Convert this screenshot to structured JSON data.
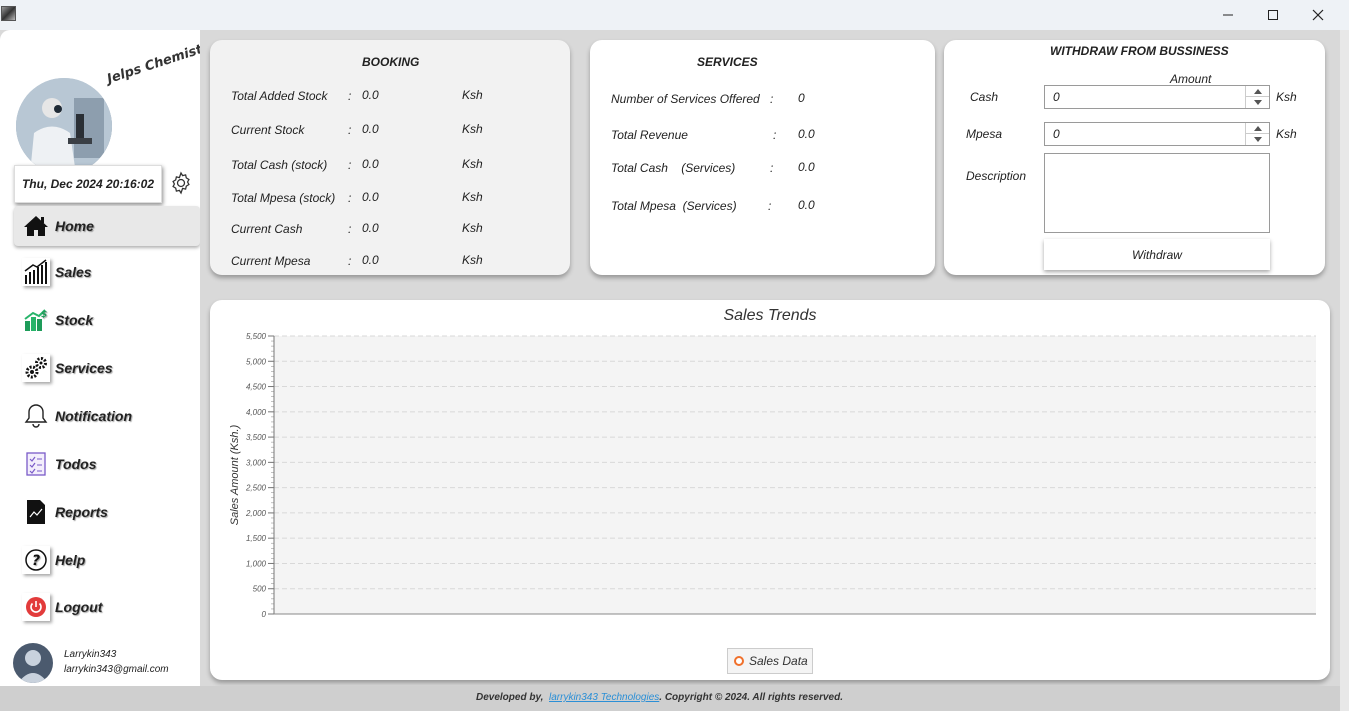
{
  "window": {
    "controls": {
      "minimize": "minimize-icon",
      "maximize": "maximize-icon",
      "close": "close-icon"
    }
  },
  "sidebar": {
    "brand": "Jelps Chemist",
    "datetime": "Thu, Dec 2024 20:16:02",
    "settings_icon": "gear-icon",
    "items": [
      {
        "label": "Home",
        "icon": "home-icon",
        "active": true
      },
      {
        "label": "Sales",
        "icon": "bar-chart-icon"
      },
      {
        "label": "Stock",
        "icon": "stock-icon"
      },
      {
        "label": "Services",
        "icon": "gears-icon"
      },
      {
        "label": "Notification",
        "icon": "bell-icon"
      },
      {
        "label": "Todos",
        "icon": "checklist-icon"
      },
      {
        "label": "Reports",
        "icon": "report-icon"
      },
      {
        "label": "Help",
        "icon": "help-icon"
      },
      {
        "label": "Logout",
        "icon": "power-icon"
      }
    ],
    "user": {
      "name": "Larrykin343",
      "email": "larrykin343@gmail.com"
    }
  },
  "booking": {
    "title": "BOOKING",
    "rows": [
      {
        "label": "Total Added Stock",
        "sep": ":",
        "value": "0.0",
        "unit": "Ksh"
      },
      {
        "label": "Current Stock",
        "sep": ":",
        "value": "0.0",
        "unit": "Ksh"
      },
      {
        "label": "Total Cash (stock)",
        "sep": ":",
        "value": "0.0",
        "unit": "Ksh"
      },
      {
        "label": "Total Mpesa (stock)",
        "sep": ":",
        "value": "0.0",
        "unit": "Ksh"
      },
      {
        "label": "Current Cash",
        "sep": ":",
        "value": "0.0",
        "unit": "Ksh"
      },
      {
        "label": "Current Mpesa",
        "sep": ":",
        "value": "0.0",
        "unit": "Ksh"
      }
    ]
  },
  "services": {
    "title": "SERVICES",
    "rows": [
      {
        "label": "Number of Services Offered",
        "sep": ":",
        "value": "0"
      },
      {
        "label": "Total Revenue",
        "sep": ":",
        "value": "0.0"
      },
      {
        "label": "Total Cash    (Services)",
        "sep": ":",
        "value": "0.0"
      },
      {
        "label": "Total Mpesa  (Services)",
        "sep": ":",
        "value": "0.0"
      }
    ]
  },
  "withdraw": {
    "title": "WITHDRAW FROM BUSSINESS",
    "amount_header": "Amount",
    "cash_label": "Cash",
    "cash_value": "0",
    "cash_unit": "Ksh",
    "mpesa_label": "Mpesa",
    "mpesa_value": "0",
    "mpesa_unit": "Ksh",
    "description_label": "Description",
    "description_value": "",
    "button_label": "Withdraw"
  },
  "chart_data": {
    "type": "line",
    "title": "Sales Trends",
    "ylabel": "Sales Amount (Ksh.)",
    "xlabel": "",
    "ylim": [
      0,
      5500
    ],
    "yticks": [
      "0",
      "500",
      "1,000",
      "1,500",
      "2,000",
      "2,500",
      "3,000",
      "3,500",
      "4,000",
      "4,500",
      "5,000",
      "5,500"
    ],
    "series": [
      {
        "name": "Sales Data",
        "values": [],
        "color": "#f0702b"
      }
    ],
    "grid": true,
    "legend": "bottom-center"
  },
  "footer": {
    "prefix": "Developed by,",
    "company": "larrykin343 Technologies",
    "suffix": ".  Copyright © 2024. All rights reserved."
  }
}
